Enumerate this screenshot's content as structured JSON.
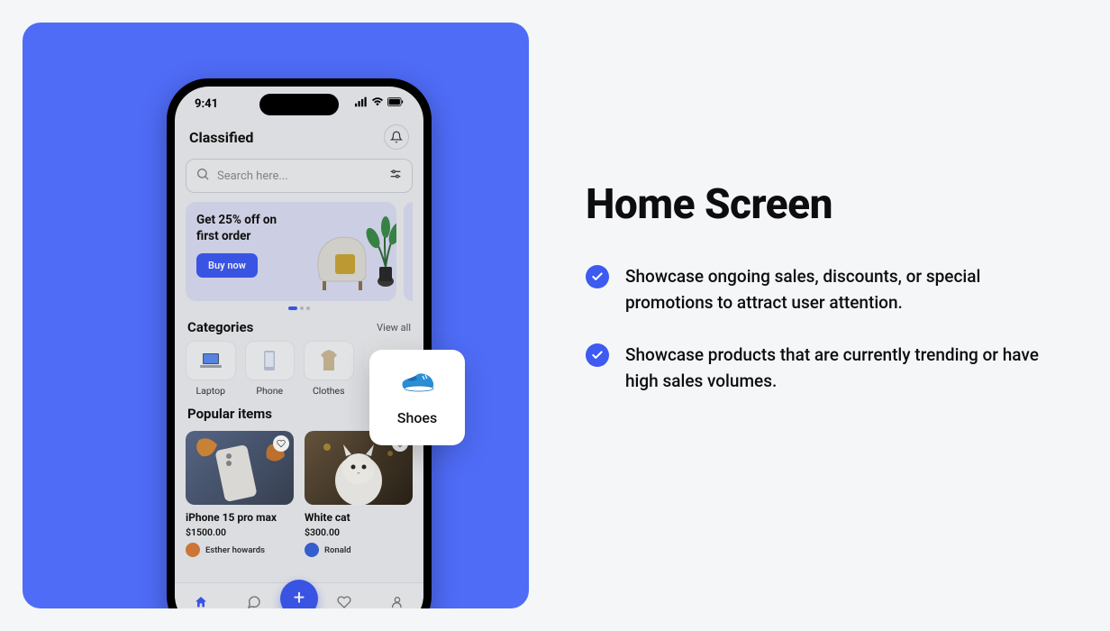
{
  "presentation": {
    "heading": "Home Screen",
    "bullets": [
      "Showcase ongoing sales, discounts, or special promotions to attract user attention.",
      "Showcase products that are currently trending or have high sales volumes."
    ]
  },
  "floating_card": {
    "label": "Shoes",
    "icon": "shoe-icon"
  },
  "phone": {
    "status": {
      "time": "9:41"
    },
    "header": {
      "title": "Classified"
    },
    "search": {
      "placeholder": "Search here..."
    },
    "promo": {
      "title": "Get 25% off on first order",
      "cta": "Buy now"
    },
    "categories": {
      "title": "Categories",
      "view_all": "View all",
      "items": [
        "Laptop",
        "Phone",
        "Clothes",
        ""
      ]
    },
    "popular": {
      "title": "Popular items",
      "items": [
        {
          "name": "iPhone 15 pro max",
          "price": "$1500.00",
          "seller": "Esther howards"
        },
        {
          "name": "White cat",
          "price": "$300.00",
          "seller": "Ronald"
        }
      ]
    },
    "nav": {
      "items": [
        "Home",
        "Chats",
        "",
        "Favorites",
        "Profile"
      ]
    }
  }
}
